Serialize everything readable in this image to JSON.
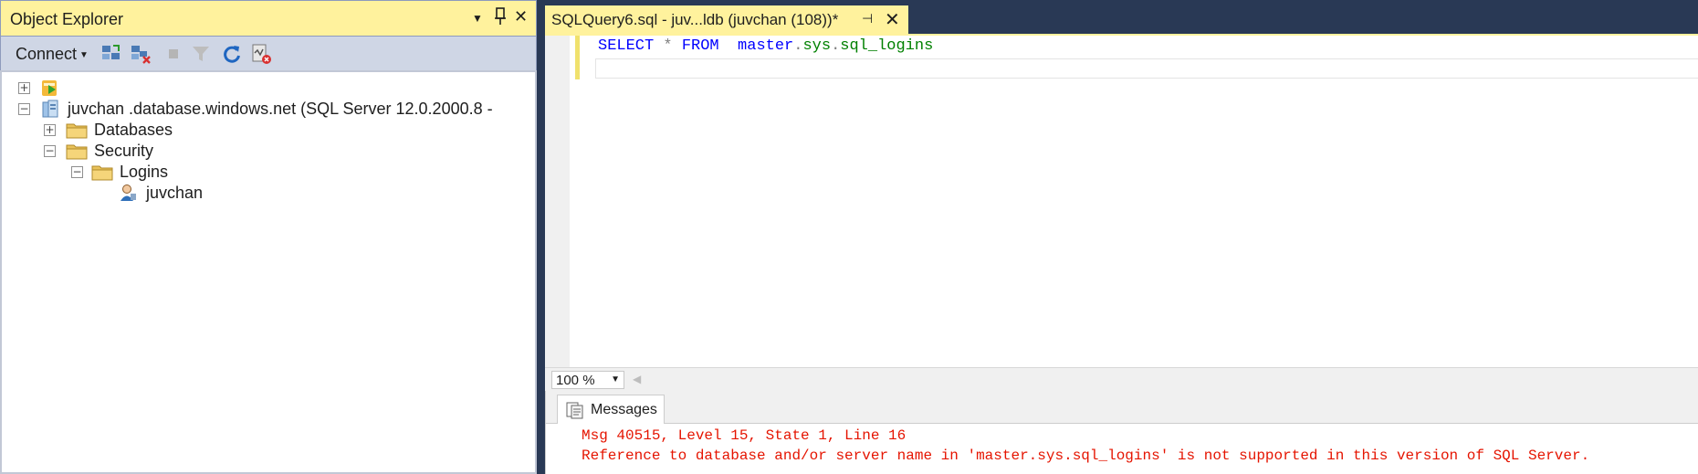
{
  "object_explorer": {
    "title": "Object Explorer",
    "window_controls": [
      "dropdown-arrow",
      "pin",
      "close"
    ],
    "toolbar": {
      "connect_label": "Connect",
      "icons": [
        "connect-object-explorer-icon",
        "disconnect-icon",
        "stop-icon",
        "filter-icon",
        "refresh-icon",
        "activity-monitor-icon"
      ]
    },
    "tree": [
      {
        "id": "root-unnamed",
        "expander": "+",
        "label": "",
        "icon": "server-group-icon"
      },
      {
        "id": "server",
        "expander": "−",
        "label": "juvchan          .database.windows.net (SQL Server 12.0.2000.8 -",
        "icon": "server-icon"
      },
      {
        "id": "databases",
        "expander": "+",
        "label": "Databases",
        "icon": "folder-icon"
      },
      {
        "id": "security",
        "expander": "−",
        "label": "Security",
        "icon": "folder-icon"
      },
      {
        "id": "logins",
        "expander": "−",
        "label": "Logins",
        "icon": "folder-icon"
      },
      {
        "id": "login-juvchan",
        "expander": "",
        "label": "juvchan",
        "icon": "login-user-icon"
      }
    ]
  },
  "editor": {
    "tab_title": "SQLQuery6.sql - juv...ldb (juvchan (108))*",
    "tab_pin": "⊣",
    "tab_close": "✕",
    "query_tokens": {
      "select": "SELECT",
      "star": " * ",
      "from": "FROM",
      "gap": "  ",
      "schema1": "master",
      "dot1": ".",
      "schema2": "sys",
      "dot2": ".",
      "object": "sql_logins"
    },
    "zoom": "100 %"
  },
  "results": {
    "tab_label": "Messages",
    "messages": [
      "Msg 40515, Level 15, State 1, Line 16",
      "Reference to database and/or server name in 'master.sys.sql_logins' is not supported in this version of SQL Server."
    ]
  },
  "colors": {
    "keyword": "#0000ff",
    "system_object": "#008000",
    "error_text": "#e51400",
    "tab_active": "#fff29d",
    "frame_dark": "#293955"
  }
}
